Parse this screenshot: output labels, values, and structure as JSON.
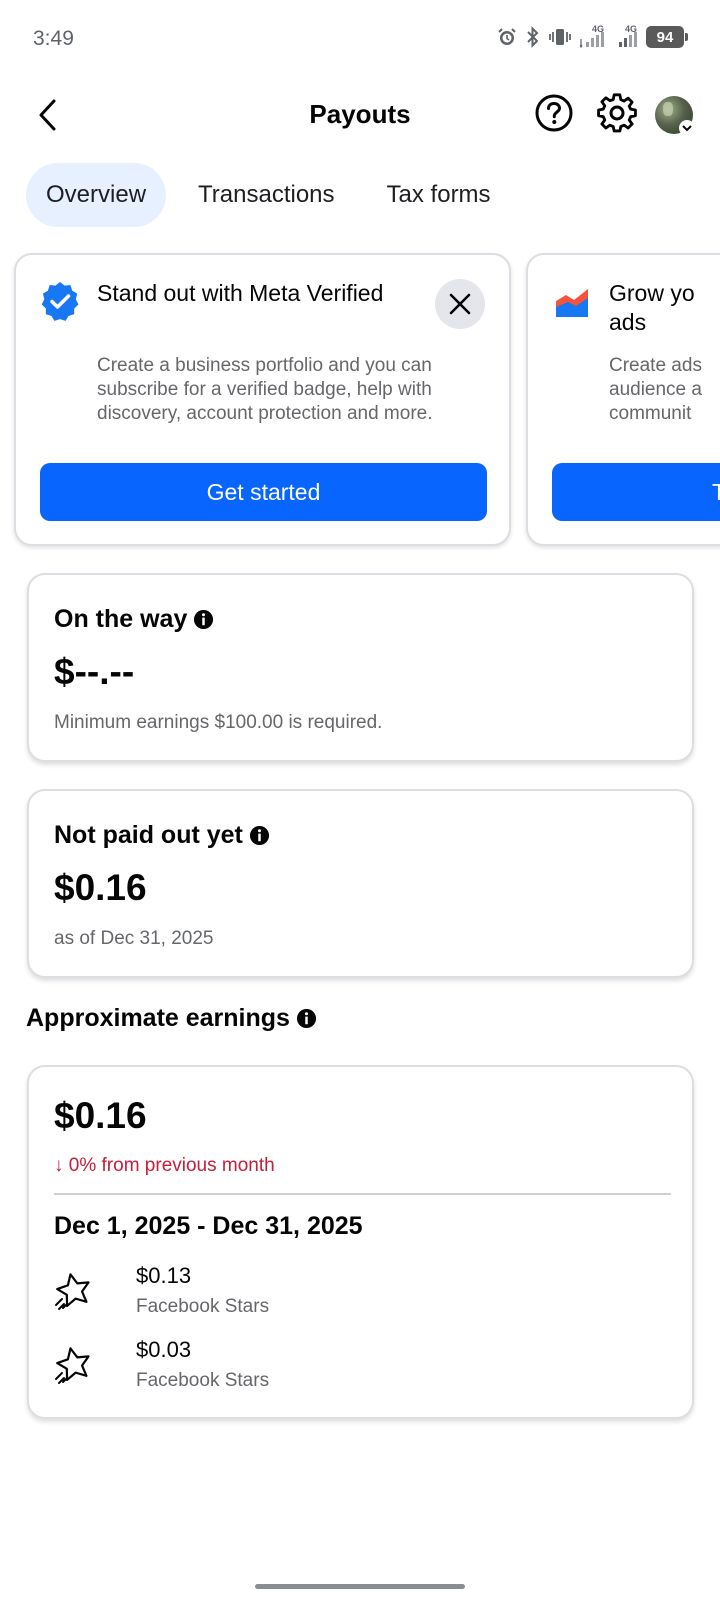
{
  "status_bar": {
    "time": "3:49",
    "battery": "94",
    "network_1": "4G",
    "network_2": "4G"
  },
  "header": {
    "title": "Payouts",
    "back_icon": "chevron-left-icon",
    "help_icon": "question-circle-icon",
    "settings_icon": "gear-icon"
  },
  "tabs": [
    {
      "label": "Overview",
      "active": true
    },
    {
      "label": "Transactions",
      "active": false
    },
    {
      "label": "Tax forms",
      "active": false
    }
  ],
  "promos": [
    {
      "title": "Stand out with Meta Verified",
      "body": "Create a business portfolio and you can subscribe for a verified badge, help with discovery, account protection and more.",
      "cta": "Get started",
      "icon": "verified-badge-icon"
    },
    {
      "title": "Grow yo\nads",
      "body": "Create ads\naudience a\ncommunit",
      "cta": "T",
      "icon": "chart-icon"
    }
  ],
  "on_the_way": {
    "title": "On the way",
    "amount": "$--.--",
    "note": "Minimum earnings $100.00 is required."
  },
  "not_paid": {
    "title": "Not paid out yet",
    "amount": "$0.16",
    "note": "as of Dec 31, 2025"
  },
  "approx": {
    "heading": "Approximate earnings",
    "amount": "$0.16",
    "delta": "↓ 0% from previous month",
    "period": "Dec 1, 2025 - Dec 31, 2025",
    "items": [
      {
        "amount": "$0.13",
        "source": "Facebook Stars"
      },
      {
        "amount": "$0.03",
        "source": "Facebook Stars"
      }
    ]
  },
  "colors": {
    "accent": "#0866ff",
    "tab_active_bg": "#e7f0fe",
    "negative": "#c41e3a"
  }
}
